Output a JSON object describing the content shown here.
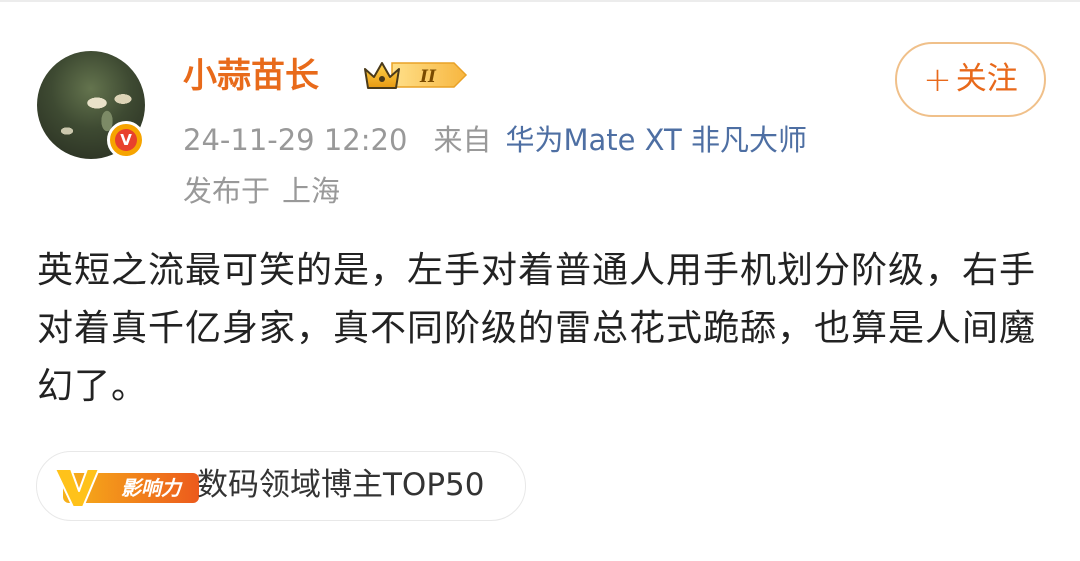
{
  "post": {
    "author": {
      "name": "小蒜苗长",
      "avatar_icon": "avatar-photo",
      "verified_badge": "V",
      "vip_level": "II"
    },
    "follow_button": {
      "icon": "plus-icon",
      "plus": "+",
      "label": "关注"
    },
    "timestamp": "24-11-29 12:20",
    "source_label": "来自",
    "device": "华为Mate XT 非凡大师",
    "location_label": "发布于",
    "location": "上海",
    "content": "英短之流最可笑的是，左手对着普通人用手机划分阶级，右手对着真千亿身家，真不同阶级的雷总花式跪舔，也算是人间魔幻了。",
    "tag": {
      "badge_letter": "V",
      "badge_label": "影响力",
      "text": "数码领域博主TOP50"
    }
  },
  "colors": {
    "username": "#e86a1a",
    "device_link": "#4e6fa3",
    "meta_text": "#999999",
    "follow_text": "#e8691b",
    "follow_border": "#f0c08a",
    "body_text": "#222222",
    "influence_gradient": [
      "#f7b21a",
      "#ec5a1c"
    ]
  }
}
